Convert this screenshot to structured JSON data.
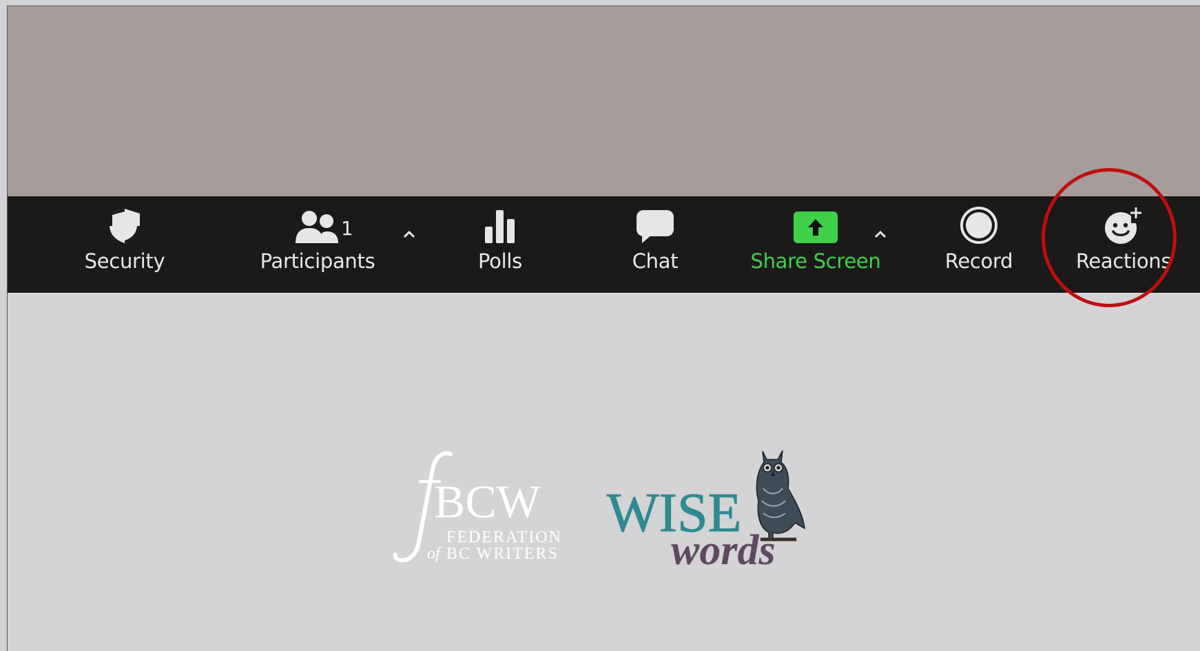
{
  "toolbar": {
    "security": {
      "label": "Security",
      "icon": "shield-icon"
    },
    "participants": {
      "label": "Participants",
      "count": "1",
      "icon": "participants-icon"
    },
    "polls": {
      "label": "Polls",
      "icon": "polls-icon"
    },
    "chat": {
      "label": "Chat",
      "icon": "chat-icon"
    },
    "share_screen": {
      "label": "Share Screen",
      "icon": "share-screen-icon",
      "color": "#3fd14a"
    },
    "record": {
      "label": "Record",
      "icon": "record-icon"
    },
    "reactions": {
      "label": "Reactions",
      "icon": "reactions-icon"
    }
  },
  "colors": {
    "toolbar_bg": "#1a1a18",
    "video_bg": "#a69c99",
    "page_bg": "#d4d3d5",
    "highlight": "#c00d0d",
    "share_green": "#3fd14a",
    "fbcw_white": "#ffffff",
    "wise_teal": "#2f8a92",
    "words_purple": "#5e4a60"
  },
  "logos": {
    "fbcw": {
      "mark": "BCW",
      "line1": "FEDERATION",
      "line2_of": "of",
      "line2": "BC WRITERS"
    },
    "wisewords": {
      "wise": "WISE",
      "words": "words"
    }
  }
}
